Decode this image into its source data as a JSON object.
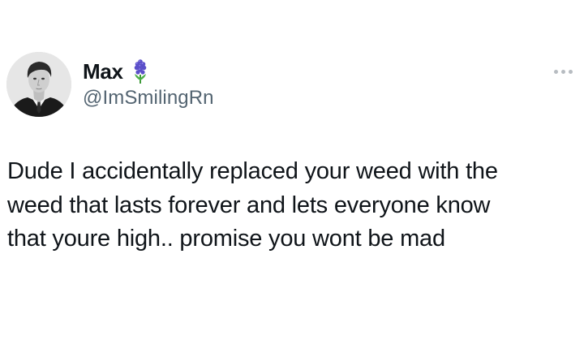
{
  "author": {
    "display_name": "Max",
    "handle": "@ImSmilingRn",
    "avatar_icon": "profile-photo",
    "badge_icon": "hyacinth-flower-emoji"
  },
  "menu": {
    "icon": "more-options-icon"
  },
  "tweet": {
    "lines": [
      "Dude I accidentally replaced your weed with the",
      "weed that lasts forever and lets everyone know",
      "that youre high.. promise you wont be mad"
    ]
  },
  "colors": {
    "text": "#0f1419",
    "secondary_text": "#536471",
    "menu_dots": "#b7bcc1",
    "badge": "#5b4fc9"
  }
}
